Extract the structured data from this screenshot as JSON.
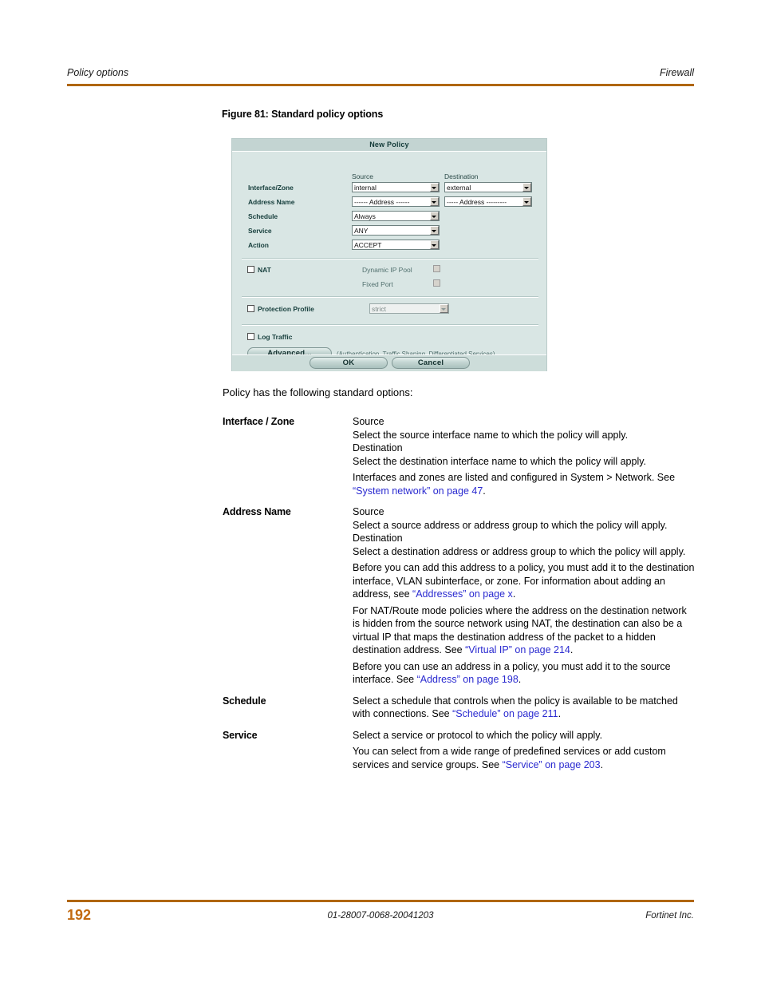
{
  "header": {
    "left": "Policy options",
    "right": "Firewall"
  },
  "figure": {
    "caption": "Figure 81: Standard policy options"
  },
  "dialog": {
    "title": "New Policy",
    "columns": {
      "source": "Source",
      "destination": "Destination"
    },
    "rows": [
      {
        "label": "Interface/Zone",
        "source_value": "internal",
        "destination_value": "external"
      },
      {
        "label": "Address Name",
        "source_value": "------ Address ------",
        "destination_value": "----- Address ---------"
      },
      {
        "label": "Schedule",
        "source_value": "Always"
      },
      {
        "label": "Service",
        "source_value": "ANY"
      },
      {
        "label": "Action",
        "source_value": "ACCEPT"
      }
    ],
    "nat": {
      "label": "NAT",
      "dynamic_ip_pool_label": "Dynamic IP Pool",
      "fixed_port_label": "Fixed Port"
    },
    "protection_profile": {
      "label": "Protection Profile",
      "value": "strict"
    },
    "log_traffic": {
      "label": "Log Traffic"
    },
    "advanced": {
      "button_label": "Advanced...",
      "note": "(Authentication, Traffic Shaping, Differentiated Services)"
    },
    "buttons": {
      "ok": "OK",
      "cancel": "Cancel"
    }
  },
  "body": {
    "intro": "Policy has the following standard options:",
    "entries": [
      {
        "term": "Interface / Zone",
        "paragraphs": [
          {
            "text": "Source",
            "tight": true
          },
          {
            "text": "Select the source interface name to which the policy will apply.",
            "tight": true
          },
          {
            "text": "Destination",
            "tight": true
          },
          {
            "text": "Select the destination interface name to which the policy will apply.",
            "tight": false
          },
          {
            "pre": "Interfaces and zones are listed and configured in System > Network. See ",
            "link": "“System network” on page 47",
            "post": ".",
            "tight": true
          }
        ]
      },
      {
        "term": "Address Name",
        "paragraphs": [
          {
            "text": "Source",
            "tight": true
          },
          {
            "text": "Select a source address or address group to which the policy will apply.",
            "tight": true
          },
          {
            "text": "Destination",
            "tight": true
          },
          {
            "text": "Select a destination address or address group to which the policy will apply.",
            "tight": false
          },
          {
            "pre": "Before you can add this address to a policy, you must add it to the destination interface, VLAN subinterface, or zone. For information about adding an address, see ",
            "link": "“Addresses” on page x",
            "post": ".",
            "tight": false
          },
          {
            "pre": "For NAT/Route mode policies where the address on the destination network is hidden from the source network using NAT, the destination can also be a virtual IP that maps the destination address of the packet to a hidden destination address. See ",
            "link": "“Virtual IP” on page 214",
            "post": ".",
            "tight": false
          },
          {
            "pre": "Before you can use an address in a policy, you must add it to the source interface. See ",
            "link": "“Address” on page 198",
            "post": ".",
            "tight": true
          }
        ]
      },
      {
        "term": "Schedule",
        "paragraphs": [
          {
            "pre": "Select a schedule that controls when the policy is available to be matched with connections. See ",
            "link": "“Schedule” on page 211",
            "post": ".",
            "tight": true
          }
        ]
      },
      {
        "term": "Service",
        "paragraphs": [
          {
            "text": "Select a service or protocol to which the policy will apply.",
            "tight": false
          },
          {
            "pre": "You can select from a wide range of predefined services or add custom services and service groups. See ",
            "link": "“Service” on page 203",
            "post": ".",
            "tight": true
          }
        ]
      }
    ]
  },
  "footer": {
    "page_number": "192",
    "document_id": "01-28007-0068-20041203",
    "company": "Fortinet Inc."
  },
  "colors": {
    "rule": "#b0660d",
    "page_number": "#c26a10",
    "link": "#2a2ad0",
    "dialog_bg": "#d9e6e4",
    "dialog_title_bg": "#c3d4d2"
  }
}
